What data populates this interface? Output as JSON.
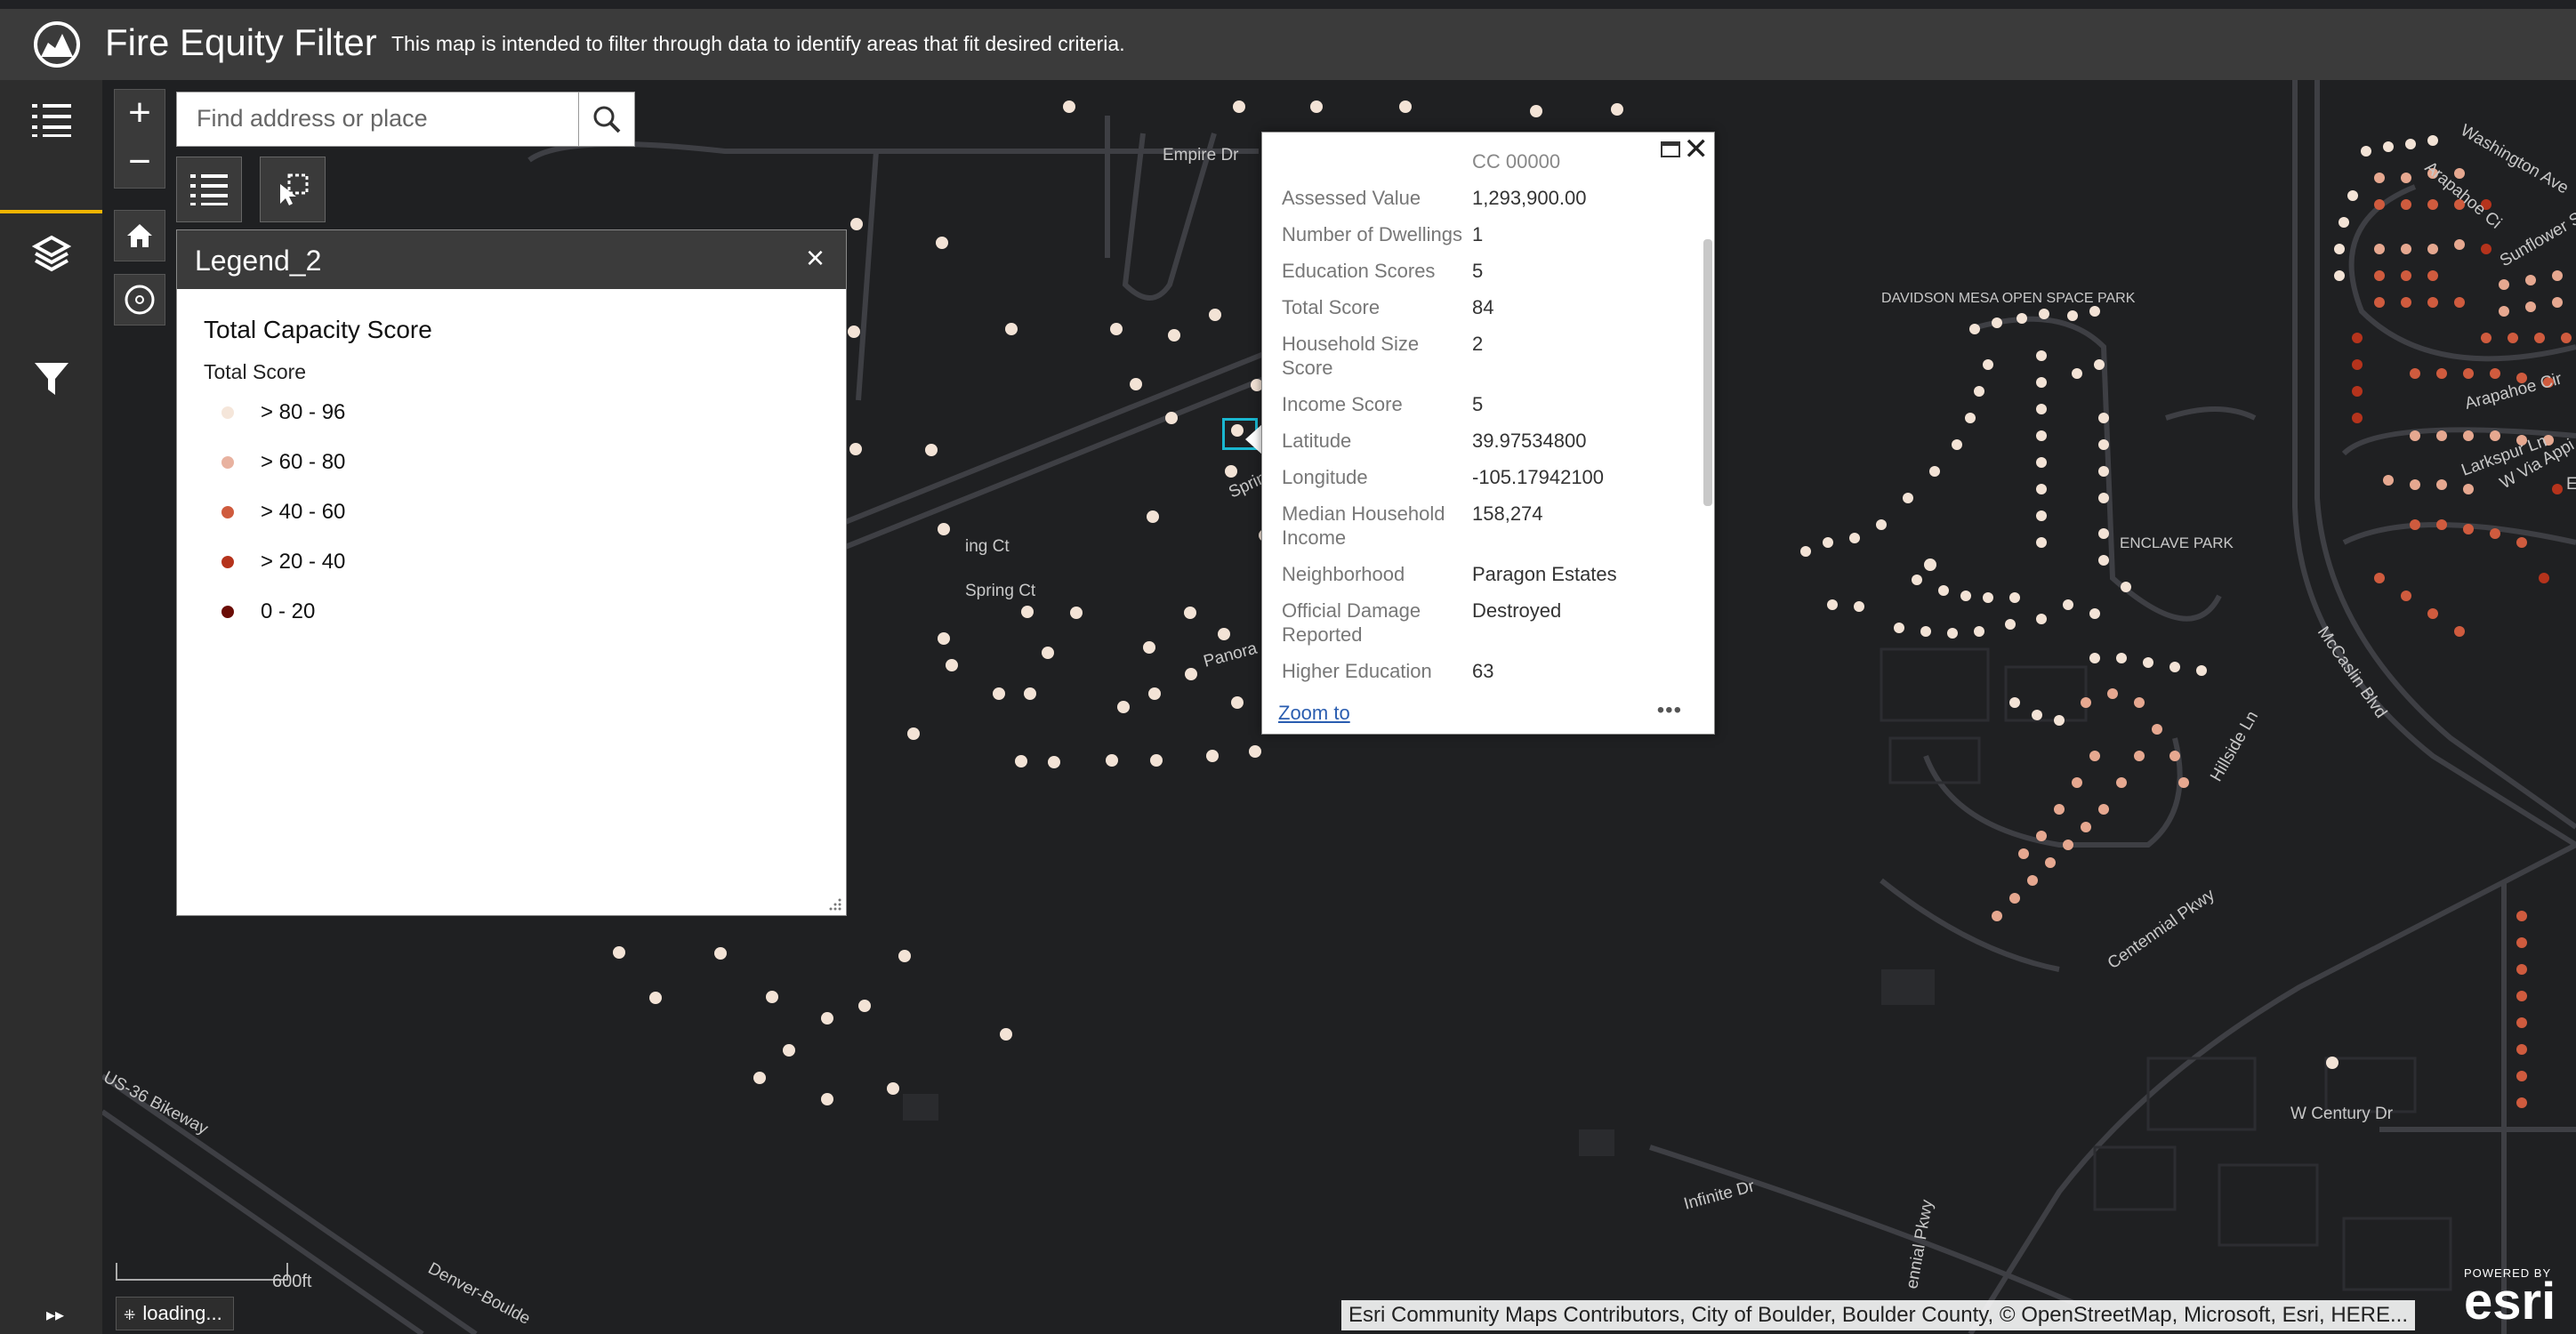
{
  "header": {
    "title": "Fire Equity Filter",
    "subtitle": "This map is intended to filter through data to identify areas that fit desired criteria."
  },
  "sidebar": {
    "items": [
      {
        "icon": "list-icon"
      },
      {
        "icon": "layers-icon"
      },
      {
        "icon": "filter-icon"
      }
    ]
  },
  "map_controls": {
    "zoom_in": "+",
    "zoom_out": "−",
    "search_placeholder": "Find address or place"
  },
  "legend": {
    "panel_title": "Legend_2",
    "close": "×",
    "layer_title": "Total Capacity Score",
    "field": "Total Score",
    "classes": [
      {
        "label": "> 80 - 96",
        "color": "#f5e6da"
      },
      {
        "label": "> 60 - 80",
        "color": "#e8b2a0"
      },
      {
        "label": "> 40 - 60",
        "color": "#cf5b3e"
      },
      {
        "label": "> 20 - 40",
        "color": "#b5331c"
      },
      {
        "label": "0 - 20",
        "color": "#6b0d06"
      }
    ]
  },
  "popup": {
    "truncated_top": "CC 00000",
    "rows": [
      {
        "label": "Assessed Value",
        "value": "1,293,900.00"
      },
      {
        "label": "Number of Dwellings",
        "value": "1"
      },
      {
        "label": "Education Scores",
        "value": "5"
      },
      {
        "label": "Total Score",
        "value": "84"
      },
      {
        "label": "Household Size Score",
        "value": "2"
      },
      {
        "label": "Income Score",
        "value": "5"
      },
      {
        "label": "Latitude",
        "value": "39.97534800"
      },
      {
        "label": "Longitude",
        "value": "-105.17942100"
      },
      {
        "label": "Median Household Income",
        "value": "158,274"
      },
      {
        "label": "Neighborhood",
        "value": "Paragon Estates"
      },
      {
        "label": "Official Damage Reported",
        "value": "Destroyed"
      },
      {
        "label": "Higher Education",
        "value": "63"
      }
    ],
    "zoom_to": "Zoom to",
    "more": "•••"
  },
  "map_labels": {
    "empire_dr": "Empire Dr",
    "spring_ct": "Spring Ct",
    "spring_ct_partial": "ing Ct",
    "spring_dr": "Spring D",
    "panorama": "Panora",
    "davidson": "DAVIDSON MESA OPEN SPACE PARK",
    "enclave": "ENCLAVE PARK",
    "mccaslin": "McCaslin Blvd",
    "hillside": "Hillside Ln",
    "centennial": "Centennial Pkwy",
    "centennial2": "ennial Pkwy",
    "w_century": "W Century Dr",
    "infinite": "Infinite Dr",
    "us36": "US-36 Bikeway",
    "denver": "Denver-Boulde",
    "washington": "Washington Ave",
    "arapahoe": "Arapahoe Cir",
    "arapahoe2": "Arapahoe Ci",
    "sunflower": "Sunflower St",
    "eldorado": "Eldorado Ln",
    "larkspur": "Larkspur Ln",
    "via_appia": "W Via Appi"
  },
  "footer": {
    "scale": "600ft",
    "loading": "loading...",
    "attribution": "Esri Community Maps Contributors, City of Boulder, Boulder County, © OpenStreetMap, Microsoft, Esri, HERE...",
    "powered_by": "POWERED BY",
    "esri": "esri"
  }
}
